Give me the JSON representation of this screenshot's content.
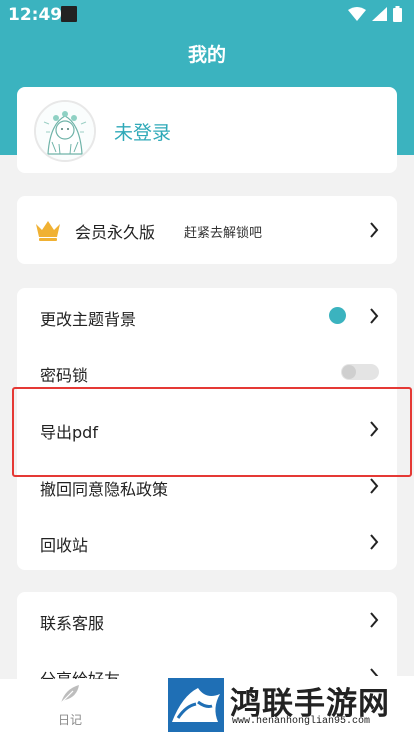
{
  "status_bar": {
    "time": "12:49"
  },
  "header": {
    "title": "我的"
  },
  "profile": {
    "login_text": "未登录"
  },
  "vip": {
    "label": "会员永久版",
    "subtitle": "赶紧去解锁吧"
  },
  "settings": {
    "items": [
      {
        "label": "更改主题背景"
      },
      {
        "label": "密码锁"
      },
      {
        "label": "导出pdf"
      },
      {
        "label": "撤回同意隐私政策"
      },
      {
        "label": "回收站"
      }
    ],
    "theme_color": "#3bb3bf",
    "password_lock_enabled": false
  },
  "contact": {
    "items": [
      {
        "label": "联系客服"
      },
      {
        "label": "分享给好友"
      }
    ]
  },
  "tab_bar": {
    "diary_label": "日记"
  },
  "watermark": {
    "title": "鸿联手游网",
    "url": "www.henanhonglian95.com"
  },
  "colors": {
    "accent": "#3bb3bf",
    "highlight": "#e53935"
  }
}
